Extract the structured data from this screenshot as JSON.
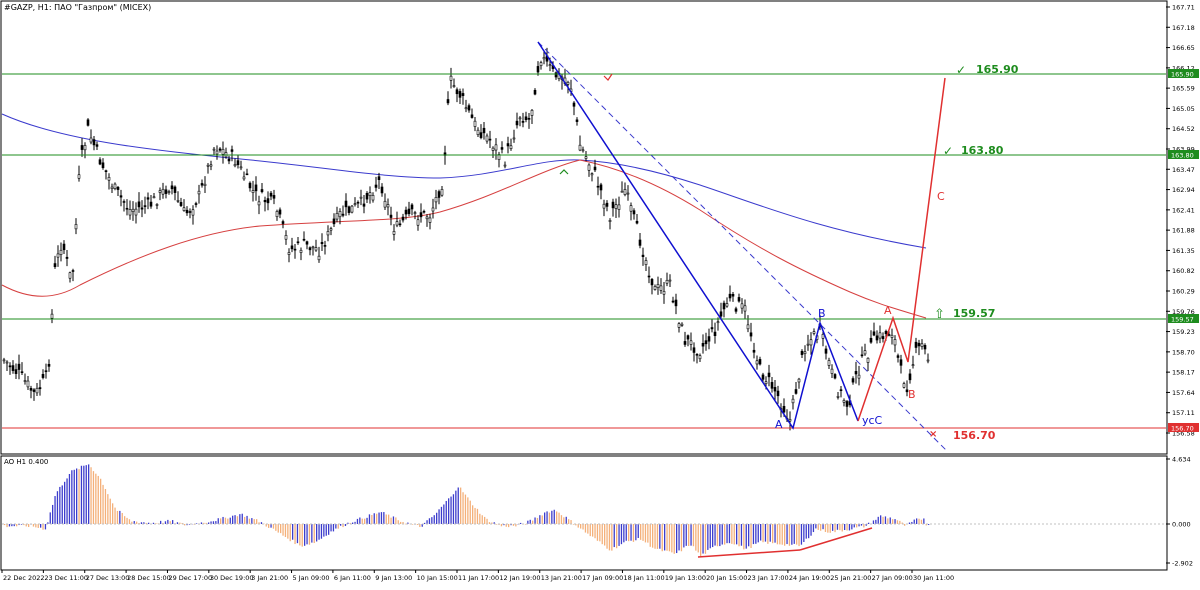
{
  "window": {
    "title": "#GAZP, H1:  ПАО \"Газпром\" (MICEX)"
  },
  "main_chart": {
    "price_axis_labels": [
      "167.71",
      "167.18",
      "166.65",
      "166.12",
      "165.59",
      "165.05",
      "164.52",
      "163.99",
      "163.47",
      "162.94",
      "162.41",
      "161.88",
      "161.35",
      "160.82",
      "160.29",
      "159.76",
      "159.23",
      "158.70",
      "158.17",
      "157.64",
      "157.11",
      "156.58"
    ],
    "price_badges": {
      "165.90": "165.90",
      "163.80": "163.80",
      "159.57": "159.57",
      "156.70": "156.70"
    },
    "levels": [
      {
        "label": "165.90",
        "color": "#1e8c1e"
      },
      {
        "label": "163.80",
        "color": "#1e8c1e"
      },
      {
        "label": "159.57",
        "color": "#1e8c1e"
      },
      {
        "label": "156.70",
        "color": "#e03030"
      }
    ],
    "wave_labels_blue": [
      "A",
      "B",
      "усC"
    ],
    "wave_labels_red": [
      "A",
      "B",
      "C"
    ]
  },
  "ao_panel": {
    "title": "AO H1  0.400",
    "axis_labels": [
      "4.634",
      "0.000",
      "-2.902"
    ]
  },
  "time_axis": [
    "22 Dec 2022",
    "23 Dec 11:00",
    "27 Dec 13:00",
    "28 Dec 15:00",
    "29 Dec 17:00",
    "30 Dec 19:00",
    "3 Jan 21:00",
    "5 Jan 09:00",
    "6 Jan 11:00",
    "9 Jan 13:00",
    "10 Jan 15:00",
    "11 Jan 17:00",
    "12 Jan 19:00",
    "13 Jan 21:00",
    "17 Jan 09:00",
    "18 Jan 11:00",
    "19 Jan 13:00",
    "20 Jan 15:00",
    "23 Jan 17:00",
    "24 Jan 19:00",
    "25 Jan 21:00",
    "27 Jan 09:00",
    "30 Jan 11:00"
  ],
  "colors": {
    "support": "#1e8c1e",
    "target_red": "#e03030",
    "ma_blue": "#3a3acd",
    "ma_red": "#d64040",
    "ao_up": "#3c3ccc",
    "ao_down": "#f4b07a"
  }
}
